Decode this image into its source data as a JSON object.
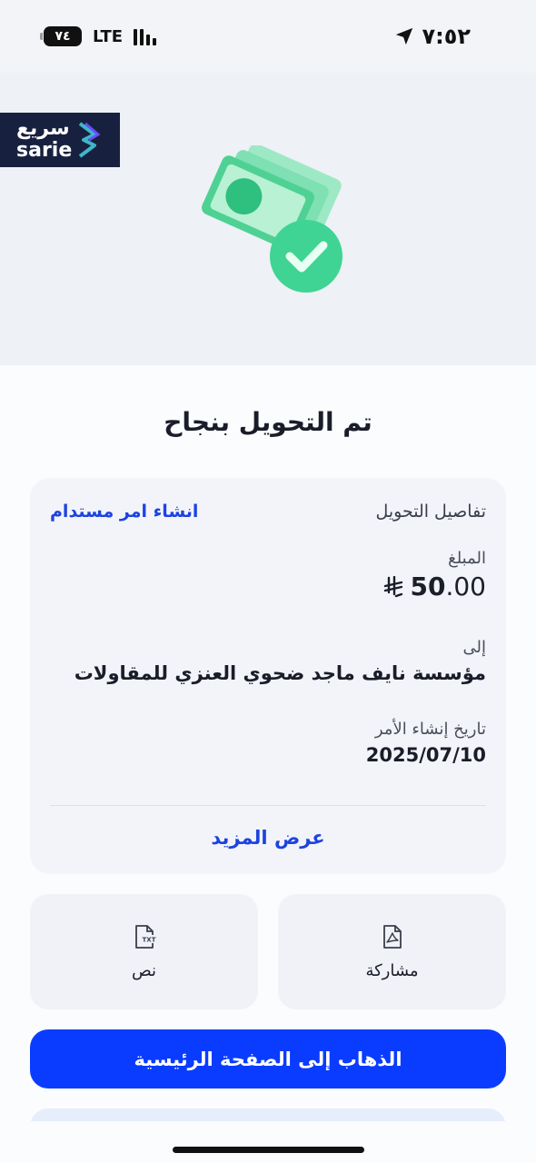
{
  "status_bar": {
    "time": "٧:٥٢",
    "battery": "٧٤",
    "network": "LTE"
  },
  "brand": {
    "name_ar": "سريع",
    "name_en": "sarie"
  },
  "title": "تم التحويل بنجاح",
  "details": {
    "header": "تفاصيل التحويل",
    "standing_order_link": "انشاء امر مستدام",
    "amount_label": "المبلغ",
    "amount_whole": "50",
    "amount_decimals": ".00",
    "currency_symbol": "⃁",
    "to_label": "إلى",
    "to_value": "مؤسسة نايف ماجد ضحوي العنزي للمقاولات",
    "date_label": "تاريخ إنشاء الأمر",
    "date_value": "2025/07/10",
    "show_more": "عرض المزيد"
  },
  "actions": {
    "share_label": "مشاركة",
    "text_label": "نص",
    "text_icon_caption": "TXT"
  },
  "primary_button": "الذهاب إلى الصفحة الرئيسية",
  "colors": {
    "accent": "#0a3cff",
    "link": "#1d43e0",
    "success": "#2ecf8a"
  }
}
